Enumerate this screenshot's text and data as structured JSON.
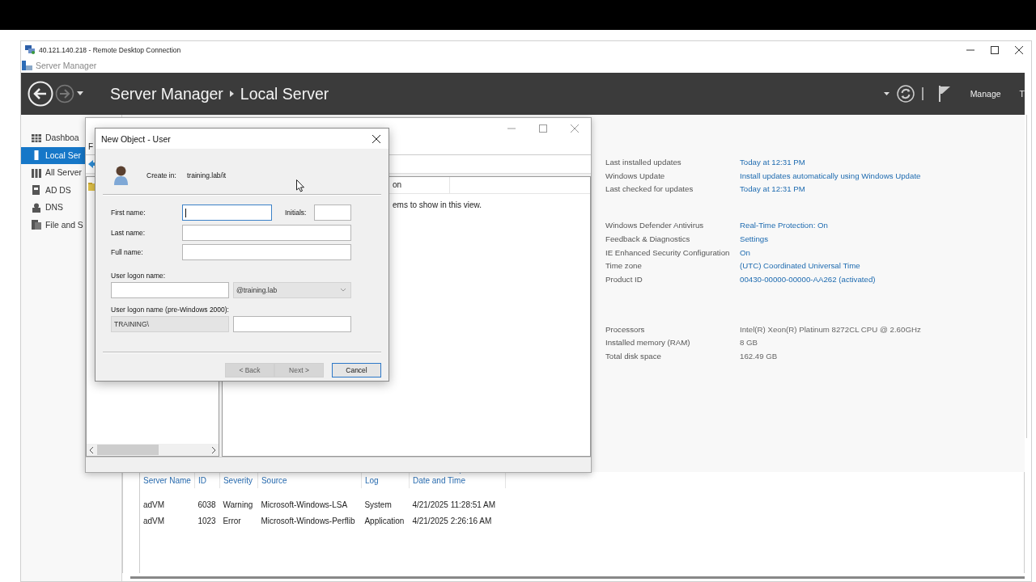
{
  "rdp_window": {
    "title": "40.121.140.218 - Remote Desktop Connection"
  },
  "app_window": {
    "title": "Server Manager"
  },
  "header": {
    "breadcrumb": [
      "Server Manager",
      "Local Server"
    ],
    "menu": [
      "Manage",
      "T"
    ]
  },
  "sidebar": {
    "items": [
      {
        "label": "Dashboa",
        "kind": "dashboard",
        "selected": false
      },
      {
        "label": "Local Ser",
        "kind": "server",
        "selected": true
      },
      {
        "label": "All Server",
        "kind": "servers",
        "selected": false
      },
      {
        "label": "AD DS",
        "kind": "adds",
        "selected": false
      },
      {
        "label": "DNS",
        "kind": "dns",
        "selected": false
      },
      {
        "label": "File and S",
        "kind": "files",
        "selected": false
      }
    ]
  },
  "properties": {
    "groups": [
      [
        {
          "label": "Last installed updates",
          "value": "Today at 12:31 PM",
          "kind": "link"
        },
        {
          "label": "Windows Update",
          "value": "Install updates automatically using Windows Update",
          "kind": "link"
        },
        {
          "label": "Last checked for updates",
          "value": "Today at 12:31 PM",
          "kind": "link"
        }
      ],
      [
        {
          "label": "Windows Defender Antivirus",
          "value": "Real-Time Protection: On",
          "kind": "link"
        },
        {
          "label": "Feedback & Diagnostics",
          "value": "Settings",
          "kind": "link"
        },
        {
          "label": "IE Enhanced Security Configuration",
          "value": "On",
          "kind": "link"
        },
        {
          "label": "Time zone",
          "value": "(UTC) Coordinated Universal Time",
          "kind": "link"
        },
        {
          "label": "Product ID",
          "value": "00430-00000-00000-AA262 (activated)",
          "kind": "link"
        }
      ],
      [
        {
          "label": "Processors",
          "value": "Intel(R) Xeon(R) Platinum 8272CL CPU @ 2.60GHz",
          "kind": "text"
        },
        {
          "label": "Installed memory (RAM)",
          "value": "8 GB",
          "kind": "text"
        },
        {
          "label": "Total disk space",
          "value": "162.49 GB",
          "kind": "text"
        }
      ]
    ]
  },
  "events": {
    "columns": [
      {
        "label": "Server Name",
        "sorted": false
      },
      {
        "label": "ID",
        "sorted": false
      },
      {
        "label": "Severity",
        "sorted": false
      },
      {
        "label": "Source",
        "sorted": false
      },
      {
        "label": "Log",
        "sorted": false
      },
      {
        "label": "Date and Time",
        "sorted": true
      }
    ],
    "rows": [
      [
        "adVM",
        "6038",
        "Warning",
        "Microsoft-Windows-LSA",
        "System",
        "4/21/2025 11:28:51 AM"
      ],
      [
        "adVM",
        "1023",
        "Error",
        "Microsoft-Windows-Perflib",
        "Application",
        "4/21/2025 2:26:16 AM"
      ]
    ]
  },
  "aduc_window": {
    "menu_item": "F",
    "list_header": "on",
    "empty_message": "ems to show in this view."
  },
  "dialog": {
    "title": "New Object - User",
    "create_in_label": "Create in:",
    "create_in_value": "training.lab/it",
    "first_name": {
      "label": "First name:",
      "focused": true
    },
    "initials": {
      "label": "Initials:"
    },
    "last_name": {
      "label": "Last name:"
    },
    "full_name": {
      "label": "Full name:"
    },
    "logon_name": {
      "label": "User logon name:",
      "domain": "@training.lab",
      "disabled": true
    },
    "pre2000": {
      "label": "User logon name (pre-Windows 2000):",
      "prefix": "TRAINING\\",
      "disabled": true
    },
    "buttons": [
      {
        "label": "< Back",
        "disabled": true,
        "default": false
      },
      {
        "label": "Next >",
        "disabled": true,
        "default": false
      },
      {
        "label": "Cancel",
        "disabled": false,
        "default": true
      }
    ]
  }
}
